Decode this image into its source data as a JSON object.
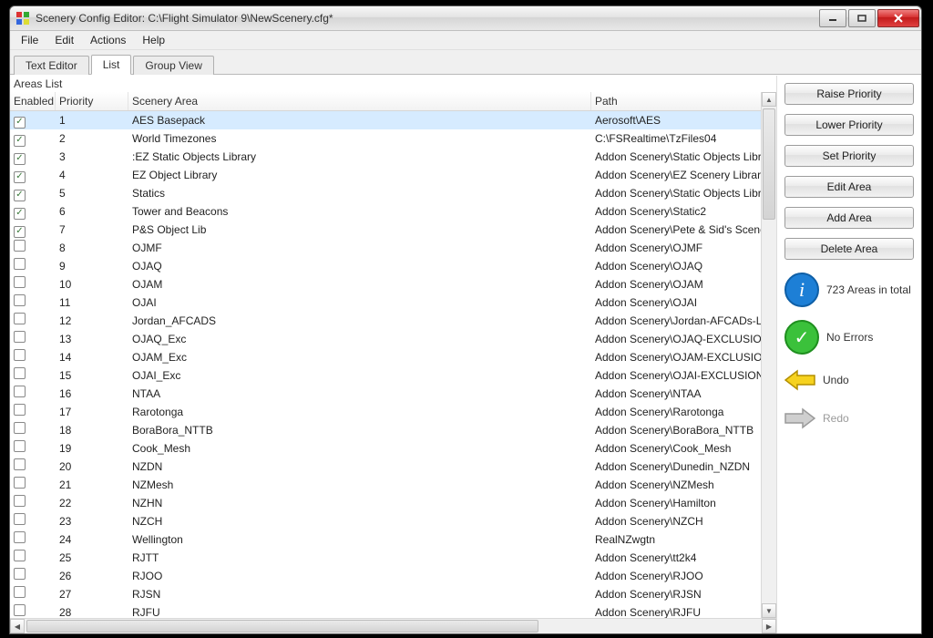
{
  "window": {
    "title": "Scenery Config Editor: C:\\Flight Simulator 9\\NewScenery.cfg*"
  },
  "menu": {
    "file": "File",
    "edit": "Edit",
    "actions": "Actions",
    "help": "Help"
  },
  "tabs": {
    "text_editor": "Text Editor",
    "list": "List",
    "group_view": "Group View"
  },
  "areas_label": "Areas List",
  "columns": {
    "enabled": "Enabled",
    "priority": "Priority",
    "scenery_area": "Scenery Area",
    "path": "Path"
  },
  "rows": [
    {
      "enabled": true,
      "priority": "1",
      "area": "AES Basepack",
      "path": "Aerosoft\\AES",
      "selected": true
    },
    {
      "enabled": true,
      "priority": "2",
      "area": "World Timezones",
      "path": "C:\\FSRealtime\\TzFiles04"
    },
    {
      "enabled": true,
      "priority": "3",
      "area": ":EZ Static Objects Library",
      "path": "Addon Scenery\\Static Objects Libr"
    },
    {
      "enabled": true,
      "priority": "4",
      "area": "EZ Object Library",
      "path": "Addon Scenery\\EZ Scenery Library"
    },
    {
      "enabled": true,
      "priority": "5",
      "area": "Statics",
      "path": "Addon Scenery\\Static Objects Libr"
    },
    {
      "enabled": true,
      "priority": "6",
      "area": "Tower and Beacons",
      "path": "Addon Scenery\\Static2"
    },
    {
      "enabled": true,
      "priority": "7",
      "area": "P&S Object Lib",
      "path": "Addon Scenery\\Pete & Sid's Scene"
    },
    {
      "enabled": false,
      "priority": "8",
      "area": "OJMF",
      "path": "Addon Scenery\\OJMF"
    },
    {
      "enabled": false,
      "priority": "9",
      "area": "OJAQ",
      "path": "Addon Scenery\\OJAQ"
    },
    {
      "enabled": false,
      "priority": "10",
      "area": "OJAM",
      "path": "Addon Scenery\\OJAM"
    },
    {
      "enabled": false,
      "priority": "11",
      "area": "OJAI",
      "path": "Addon Scenery\\OJAI"
    },
    {
      "enabled": false,
      "priority": "12",
      "area": "Jordan_AFCADS",
      "path": "Addon Scenery\\Jordan-AFCADs-L"
    },
    {
      "enabled": false,
      "priority": "13",
      "area": "OJAQ_Exc",
      "path": "Addon Scenery\\OJAQ-EXCLUSION"
    },
    {
      "enabled": false,
      "priority": "14",
      "area": "OJAM_Exc",
      "path": "Addon Scenery\\OJAM-EXCLUSION"
    },
    {
      "enabled": false,
      "priority": "15",
      "area": "OJAI_Exc",
      "path": "Addon Scenery\\OJAI-EXCLUSION"
    },
    {
      "enabled": false,
      "priority": "16",
      "area": "NTAA",
      "path": "Addon Scenery\\NTAA"
    },
    {
      "enabled": false,
      "priority": "17",
      "area": "Rarotonga",
      "path": "Addon Scenery\\Rarotonga"
    },
    {
      "enabled": false,
      "priority": "18",
      "area": "BoraBora_NTTB",
      "path": "Addon Scenery\\BoraBora_NTTB"
    },
    {
      "enabled": false,
      "priority": "19",
      "area": "Cook_Mesh",
      "path": "Addon Scenery\\Cook_Mesh"
    },
    {
      "enabled": false,
      "priority": "20",
      "area": "NZDN",
      "path": "Addon Scenery\\Dunedin_NZDN"
    },
    {
      "enabled": false,
      "priority": "21",
      "area": "NZMesh",
      "path": "Addon Scenery\\NZMesh"
    },
    {
      "enabled": false,
      "priority": "22",
      "area": "NZHN",
      "path": "Addon Scenery\\Hamilton"
    },
    {
      "enabled": false,
      "priority": "23",
      "area": "NZCH",
      "path": "Addon Scenery\\NZCH"
    },
    {
      "enabled": false,
      "priority": "24",
      "area": "Wellington",
      "path": "RealNZwgtn"
    },
    {
      "enabled": false,
      "priority": "25",
      "area": "RJTT",
      "path": "Addon Scenery\\tt2k4"
    },
    {
      "enabled": false,
      "priority": "26",
      "area": "RJOO",
      "path": "Addon Scenery\\RJOO"
    },
    {
      "enabled": false,
      "priority": "27",
      "area": "RJSN",
      "path": "Addon Scenery\\RJSN"
    },
    {
      "enabled": false,
      "priority": "28",
      "area": "RJFU",
      "path": "Addon Scenery\\RJFU"
    }
  ],
  "side": {
    "raise": "Raise Priority",
    "lower": "Lower Priority",
    "set": "Set Priority",
    "edit": "Edit Area",
    "add": "Add Area",
    "delete": "Delete Area",
    "count_text": "723 Areas in total",
    "errors_text": "No Errors",
    "undo": "Undo",
    "redo": "Redo"
  }
}
